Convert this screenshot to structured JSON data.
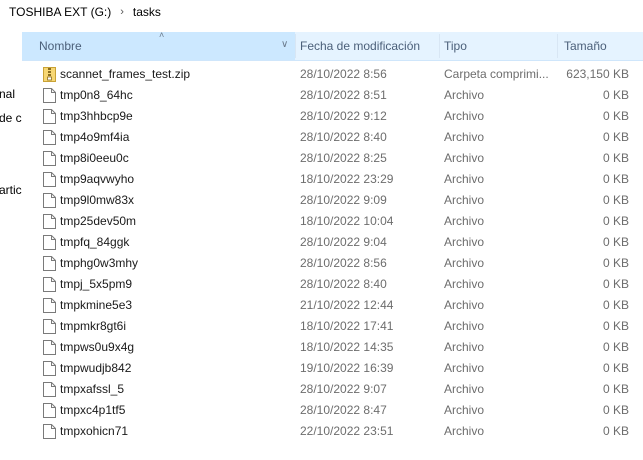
{
  "breadcrumb": {
    "drive": "TOSHIBA EXT (G:)",
    "folder": "tasks"
  },
  "nav_fragments": [
    "nal",
    "de c",
    "artic"
  ],
  "columns": {
    "name": "Nombre",
    "date": "Fecha de modificación",
    "type": "Tipo",
    "size": "Tamaño"
  },
  "files": [
    {
      "name": "scannet_frames_test.zip",
      "date": "28/10/2022 8:56",
      "type": "Carpeta comprimi...",
      "size": "623,150 KB",
      "icon": "zip-folder-icon"
    },
    {
      "name": "tmp0n8_64hc",
      "date": "28/10/2022 8:51",
      "type": "Archivo",
      "size": "0 KB",
      "icon": "file-icon"
    },
    {
      "name": "tmp3hhbcp9e",
      "date": "28/10/2022 9:12",
      "type": "Archivo",
      "size": "0 KB",
      "icon": "file-icon"
    },
    {
      "name": "tmp4o9mf4ia",
      "date": "28/10/2022 8:40",
      "type": "Archivo",
      "size": "0 KB",
      "icon": "file-icon"
    },
    {
      "name": "tmp8i0eeu0c",
      "date": "28/10/2022 8:25",
      "type": "Archivo",
      "size": "0 KB",
      "icon": "file-icon"
    },
    {
      "name": "tmp9aqvwyho",
      "date": "18/10/2022 23:29",
      "type": "Archivo",
      "size": "0 KB",
      "icon": "file-icon"
    },
    {
      "name": "tmp9l0mw83x",
      "date": "28/10/2022 9:09",
      "type": "Archivo",
      "size": "0 KB",
      "icon": "file-icon"
    },
    {
      "name": "tmp25dev50m",
      "date": "18/10/2022 10:04",
      "type": "Archivo",
      "size": "0 KB",
      "icon": "file-icon"
    },
    {
      "name": "tmpfq_84ggk",
      "date": "28/10/2022 9:04",
      "type": "Archivo",
      "size": "0 KB",
      "icon": "file-icon"
    },
    {
      "name": "tmphg0w3mhy",
      "date": "28/10/2022 8:56",
      "type": "Archivo",
      "size": "0 KB",
      "icon": "file-icon"
    },
    {
      "name": "tmpj_5x5pm9",
      "date": "28/10/2022 8:40",
      "type": "Archivo",
      "size": "0 KB",
      "icon": "file-icon"
    },
    {
      "name": "tmpkmine5e3",
      "date": "21/10/2022 12:44",
      "type": "Archivo",
      "size": "0 KB",
      "icon": "file-icon"
    },
    {
      "name": "tmpmkr8gt6i",
      "date": "18/10/2022 17:41",
      "type": "Archivo",
      "size": "0 KB",
      "icon": "file-icon"
    },
    {
      "name": "tmpws0u9x4g",
      "date": "18/10/2022 14:35",
      "type": "Archivo",
      "size": "0 KB",
      "icon": "file-icon"
    },
    {
      "name": "tmpwudjb842",
      "date": "19/10/2022 16:39",
      "type": "Archivo",
      "size": "0 KB",
      "icon": "file-icon"
    },
    {
      "name": "tmpxafssl_5",
      "date": "28/10/2022 9:07",
      "type": "Archivo",
      "size": "0 KB",
      "icon": "file-icon"
    },
    {
      "name": "tmpxc4p1tf5",
      "date": "28/10/2022 8:47",
      "type": "Archivo",
      "size": "0 KB",
      "icon": "file-icon"
    },
    {
      "name": "tmpxohicn71",
      "date": "22/10/2022 23:51",
      "type": "Archivo",
      "size": "0 KB",
      "icon": "file-icon"
    }
  ],
  "colors": {
    "header_bg": "#e5f3ff",
    "sorted_column_bg": "#cce8ff",
    "header_text": "#4c607a",
    "secondary_text": "#6d6d6d",
    "zip_icon": "#e8c250"
  }
}
